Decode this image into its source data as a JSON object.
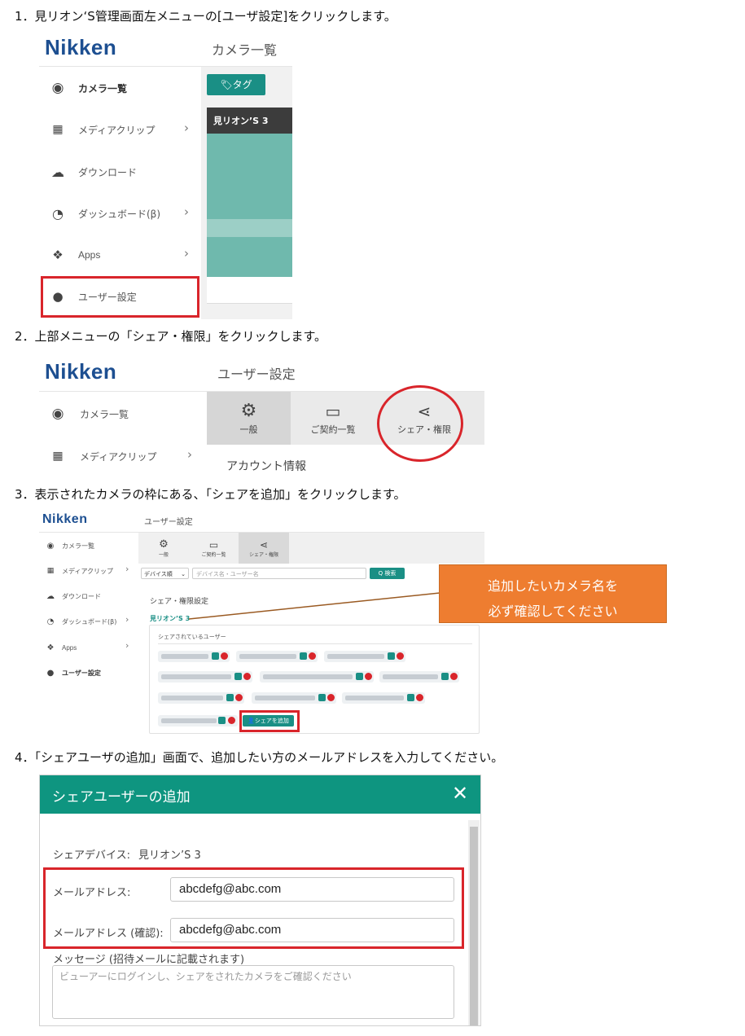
{
  "steps": {
    "s1": "1．見リオン‘S管理画面左メニューの[ユーザ設定]をクリックします。",
    "s2": "2．上部メニューの「シェア・権限」をクリックします。",
    "s3": "3．表示されたカメラの枠にある、「シェアを追加」をクリックします。",
    "s4": "4．「シェアユーザの追加」画面で、追加したい方のメールアドレスを入力してください。"
  },
  "brand": {
    "logo": "Nikken",
    "color": "#1d4f91",
    "accent": "#1a8f85",
    "highlight": "#d9252b"
  },
  "shot1": {
    "header_title": "カメラ一覧",
    "menu": [
      {
        "label": "カメラ一覧",
        "icon": "camera-icon"
      },
      {
        "label": "メディアクリップ",
        "icon": "film-icon"
      },
      {
        "label": "ダウンロード",
        "icon": "cloud-download-icon"
      },
      {
        "label": "ダッシュボード(β)",
        "icon": "dashboard-icon"
      },
      {
        "label": "Apps",
        "icon": "apps-icon"
      },
      {
        "label": "ユーザー設定",
        "icon": "user-icon"
      }
    ],
    "tag_button": "🏷タグ",
    "camera_name": "見リオン’S 3"
  },
  "shot2": {
    "header_title": "ユーザー設定",
    "menu": [
      {
        "label": "カメラ一覧"
      },
      {
        "label": "メディアクリップ"
      }
    ],
    "tabs": [
      {
        "label": "一般",
        "icon": "gears-icon"
      },
      {
        "label": "ご契約一覧",
        "icon": "card-icon"
      },
      {
        "label": "シェア・権限",
        "icon": "share-icon"
      }
    ],
    "section": "アカウント情報"
  },
  "shot3": {
    "header_title": "ユーザー設定",
    "menu": [
      {
        "label": "カメラ一覧"
      },
      {
        "label": "メディアクリップ"
      },
      {
        "label": "ダウンロード"
      },
      {
        "label": "ダッシュボード(β)"
      },
      {
        "label": "Apps"
      },
      {
        "label": "ユーザー設定"
      }
    ],
    "tabs": [
      {
        "label": "一般"
      },
      {
        "label": "ご契約一覧"
      },
      {
        "label": "シェア・権限"
      }
    ],
    "sort_select": "デバイス順",
    "search_placeholder": "デバイス名・ユーザー名",
    "search_button": "Q 検索",
    "settings_title": "シェア・権限設定",
    "camera_name": "見リオン’S 3",
    "shared_users_label": "シェアされているユーザー",
    "add_share_button": "シェアを追加",
    "callout_line1": "追加したいカメラ名を",
    "callout_line2": "必ず確認してください",
    "callout_color": "#ee7d30"
  },
  "shot4": {
    "title": "シェアユーザーの追加",
    "device_label": "シェアデバイス:",
    "device_value": "見リオン’S 3",
    "email_label": "メールアドレス:",
    "email_value": "abcdefg@abc.com",
    "email_confirm_label": "メールアドレス (確認):",
    "email_confirm_value": "abcdefg@abc.com",
    "message_label": "メッセージ (招待メールに記載されます)",
    "message_placeholder": "ビューアーにログインし、シェアをされたカメラをご確認ください",
    "header_color": "#0e9580"
  }
}
